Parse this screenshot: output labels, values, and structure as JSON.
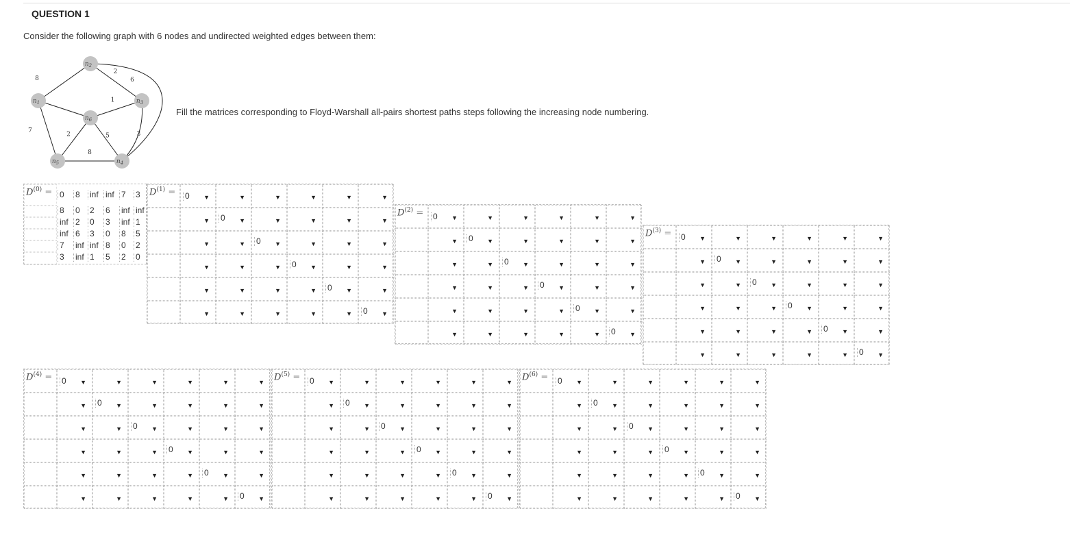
{
  "question": {
    "title": "QUESTION 1",
    "intro": "Consider the following graph with 6 nodes and undirected weighted edges between them:",
    "fill_instruction": "Fill the matrices corresponding to Floyd-Warshall all-pairs shortest paths steps following the increasing node numbering."
  },
  "graph": {
    "nodes": [
      {
        "id": "n1",
        "label": "n",
        "sub": "1"
      },
      {
        "id": "n2",
        "label": "n",
        "sub": "2"
      },
      {
        "id": "n3",
        "label": "n",
        "sub": "3"
      },
      {
        "id": "n4",
        "label": "n",
        "sub": "4"
      },
      {
        "id": "n5",
        "label": "n",
        "sub": "5"
      },
      {
        "id": "n6",
        "label": "n",
        "sub": "6"
      }
    ],
    "edges": [
      {
        "from": "n1",
        "to": "n2",
        "weight": "8"
      },
      {
        "from": "n1",
        "to": "n6",
        "weight": "3"
      },
      {
        "from": "n1",
        "to": "n5",
        "weight": "7"
      },
      {
        "from": "n2",
        "to": "n3",
        "weight": "2"
      },
      {
        "from": "n2",
        "to": "n4",
        "weight": "6"
      },
      {
        "from": "n3",
        "to": "n6",
        "weight": "1"
      },
      {
        "from": "n3",
        "to": "n4",
        "weight": "3"
      },
      {
        "from": "n6",
        "to": "n5",
        "weight": "2"
      },
      {
        "from": "n6",
        "to": "n4",
        "weight": "5"
      },
      {
        "from": "n5",
        "to": "n4",
        "weight": "8"
      }
    ]
  },
  "d0": {
    "label": "D",
    "sup": "(0)",
    "eq": "=",
    "rows": [
      [
        "0",
        "8",
        "inf",
        "inf",
        "7",
        "3"
      ],
      [
        "8",
        "0",
        "2",
        "6",
        "inf",
        "inf"
      ],
      [
        "inf",
        "2",
        "0",
        "3",
        "inf",
        "1"
      ],
      [
        "inf",
        "6",
        "3",
        "0",
        "8",
        "5"
      ],
      [
        "7",
        "inf",
        "inf",
        "8",
        "0",
        "2"
      ],
      [
        "3",
        "inf",
        "1",
        "5",
        "2",
        "0"
      ]
    ]
  },
  "matrices": [
    {
      "id": "d1",
      "label": "D",
      "sup": "(1)",
      "eq": "="
    },
    {
      "id": "d2",
      "label": "D",
      "sup": "(2)",
      "eq": "="
    },
    {
      "id": "d3",
      "label": "D",
      "sup": "(3)",
      "eq": "="
    },
    {
      "id": "d4",
      "label": "D",
      "sup": "(4)",
      "eq": "="
    },
    {
      "id": "d5",
      "label": "D",
      "sup": "(5)",
      "eq": "="
    },
    {
      "id": "d6",
      "label": "D",
      "sup": "(6)",
      "eq": "="
    }
  ],
  "dropdown": {
    "diagonal_value": "0",
    "arrow": "▼"
  },
  "colors": {
    "node_fill": "#c3c3c3",
    "edge": "#222222",
    "border": "#bbbbbb"
  }
}
